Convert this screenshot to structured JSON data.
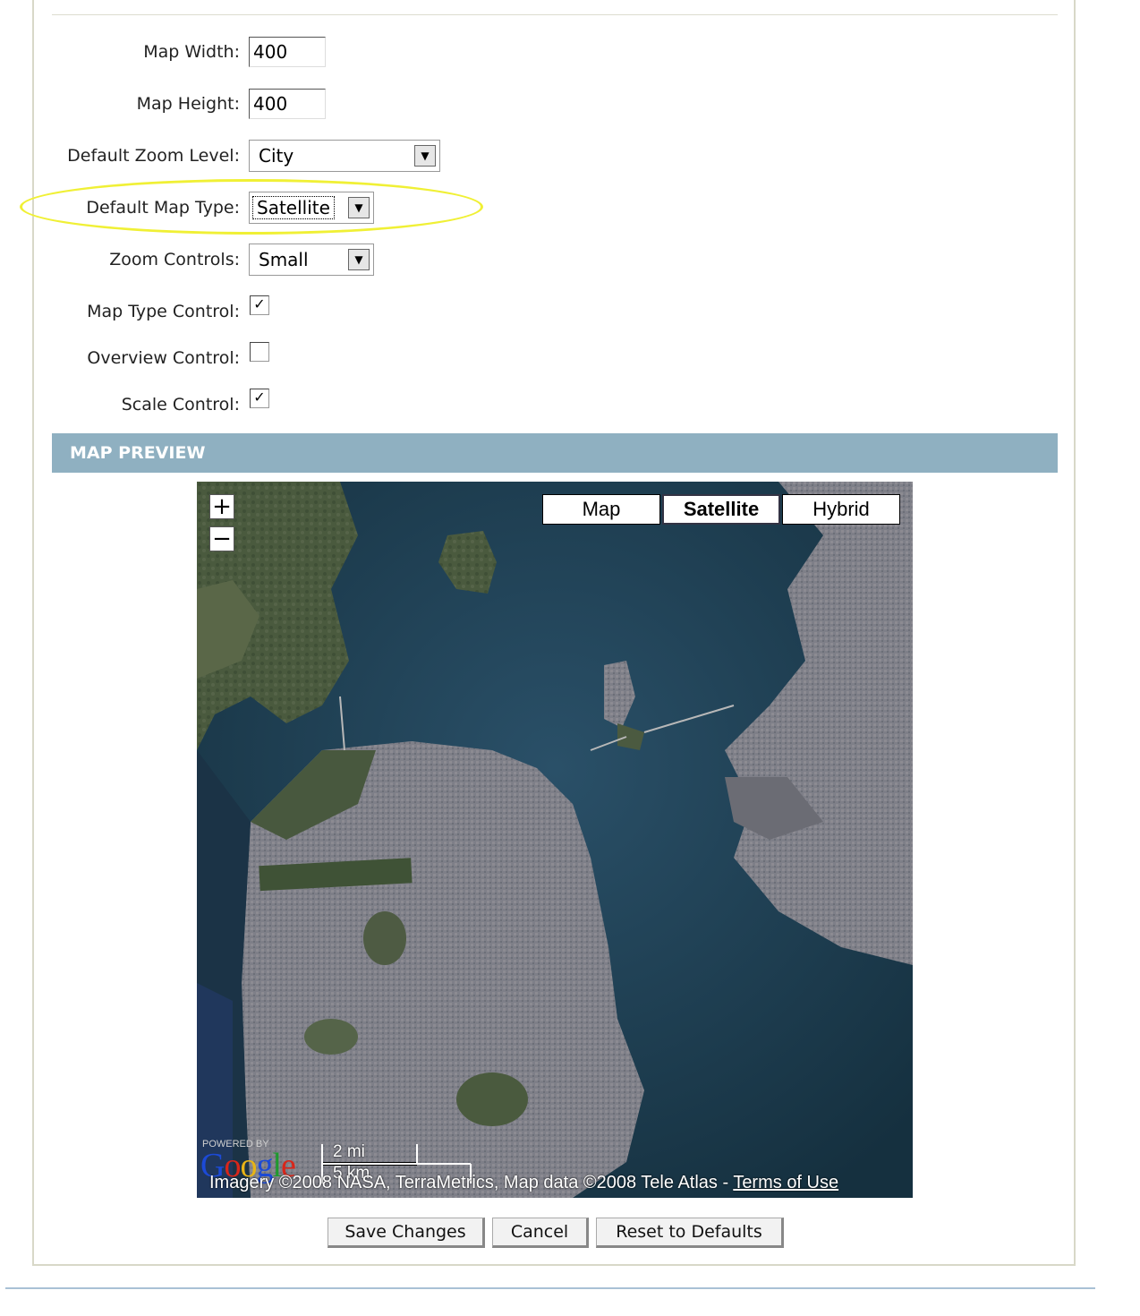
{
  "form": {
    "map_width": {
      "label": "Map Width:",
      "value": "400"
    },
    "map_height": {
      "label": "Map Height:",
      "value": "400"
    },
    "default_zoom": {
      "label": "Default Zoom Level:",
      "selected": "City"
    },
    "default_map_type": {
      "label": "Default Map Type:",
      "selected": "Satellite"
    },
    "zoom_controls": {
      "label": "Zoom Controls:",
      "selected": "Small"
    },
    "map_type_control": {
      "label": "Map Type Control:",
      "checked": true
    },
    "overview_control": {
      "label": "Overview Control:",
      "checked": false
    },
    "scale_control": {
      "label": "Scale Control:",
      "checked": true
    }
  },
  "section": {
    "title": "MAP PREVIEW"
  },
  "map": {
    "zoom_in": "+",
    "zoom_out": "−",
    "types": [
      "Map",
      "Satellite",
      "Hybrid"
    ],
    "active_type": "Satellite",
    "powered_by": "POWERED BY",
    "logo_letters": [
      "G",
      "o",
      "o",
      "g",
      "l",
      "e"
    ],
    "scale_mi": "2 mi",
    "scale_km": "5 km",
    "copyright": "Imagery ©2008 NASA, TerraMetrics, Map data ©2008 Tele Atlas - ",
    "terms": "Terms of Use"
  },
  "buttons": {
    "save": "Save Changes",
    "cancel": "Cancel",
    "reset": "Reset to Defaults"
  },
  "colors": {
    "section_bar": "#8fb0c1",
    "highlight": "#f0f035",
    "water": "#1d3c50"
  }
}
